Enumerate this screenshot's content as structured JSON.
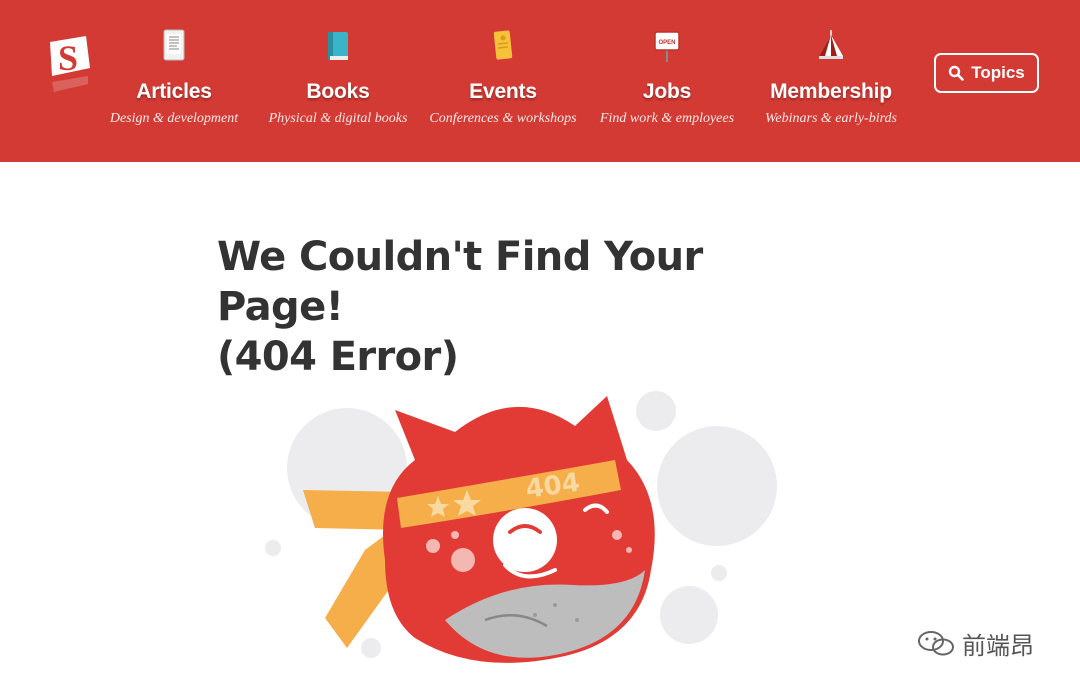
{
  "header": {
    "logo_letter": "S",
    "brand_color": "#d33a34",
    "nav": [
      {
        "title": "Articles",
        "subtitle": "Design & development",
        "icon": "tablet-icon"
      },
      {
        "title": "Books",
        "subtitle": "Physical & digital books",
        "icon": "book-icon"
      },
      {
        "title": "Events",
        "subtitle": "Conferences & workshops",
        "icon": "ticket-icon"
      },
      {
        "title": "Jobs",
        "subtitle": "Find work & employees",
        "icon": "open-sign-icon",
        "icon_text": "OPEN"
      },
      {
        "title": "Membership",
        "subtitle": "Webinars & early-birds",
        "icon": "circus-tent-icon"
      }
    ],
    "topics_label": "Topics"
  },
  "main": {
    "title_line1": "We Couldn't Find Your Page!",
    "title_line2": "(404 Error)",
    "illustration": {
      "description_icon": "cat-mascot-illustration",
      "headband_text": "404"
    }
  },
  "watermark": {
    "text": "前端昂"
  }
}
